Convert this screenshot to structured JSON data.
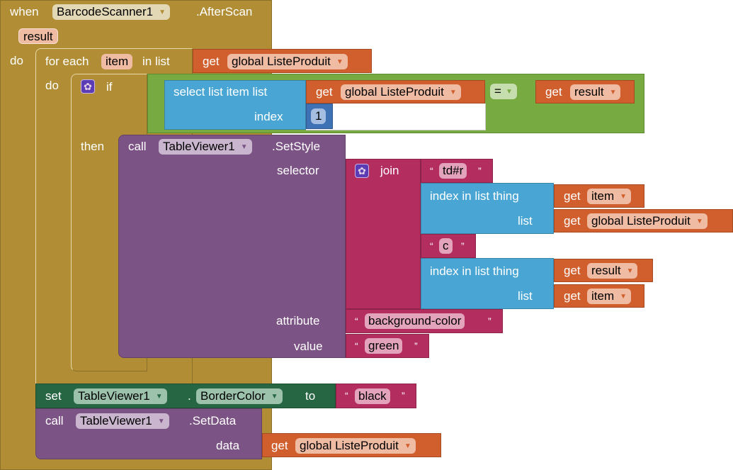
{
  "event": {
    "when": "when",
    "component": "BarcodeScanner1",
    "event_name": ".AfterScan",
    "param": "result",
    "do": "do"
  },
  "foreach": {
    "label1": "for each",
    "var": "item",
    "label2": "in list",
    "do": "do",
    "list_get": "get",
    "list_var": "global ListeProduit"
  },
  "if_block": {
    "if": "if",
    "then": "then",
    "select": "select list item  list",
    "index_label": "index",
    "get": "get",
    "list_var": "global ListeProduit",
    "index_value": "1",
    "op": "=",
    "right_get": "get",
    "right_var": "result"
  },
  "setstyle": {
    "call": "call",
    "component": "TableViewer1",
    "method": ".SetStyle",
    "selector": "selector",
    "attribute": "attribute",
    "value": "value",
    "join": "join",
    "str1": "td#r",
    "idx1_label": "index in list  thing",
    "idx1_list": "list",
    "idx1_thing_get": "get",
    "idx1_thing_var": "item",
    "idx1_list_get": "get",
    "idx1_list_var": "global ListeProduit",
    "str2": "c",
    "idx2_label": "index in list  thing",
    "idx2_list": "list",
    "idx2_thing_get": "get",
    "idx2_thing_var": "result",
    "idx2_list_get": "get",
    "idx2_list_var": "item",
    "attr_value": "background-color",
    "val_value": "green"
  },
  "setprop": {
    "set": "set",
    "component": "TableViewer1",
    "dot": ".",
    "property": "BorderColor",
    "to": "to",
    "value": "black"
  },
  "setdata": {
    "call": "call",
    "component": "TableViewer1",
    "method": ".SetData",
    "data": "data",
    "get": "get",
    "var": "global ListeProduit"
  },
  "symbols": {
    "arrow": "▼",
    "open_quote": "“",
    "close_quote": "”",
    "gear": "✿"
  }
}
